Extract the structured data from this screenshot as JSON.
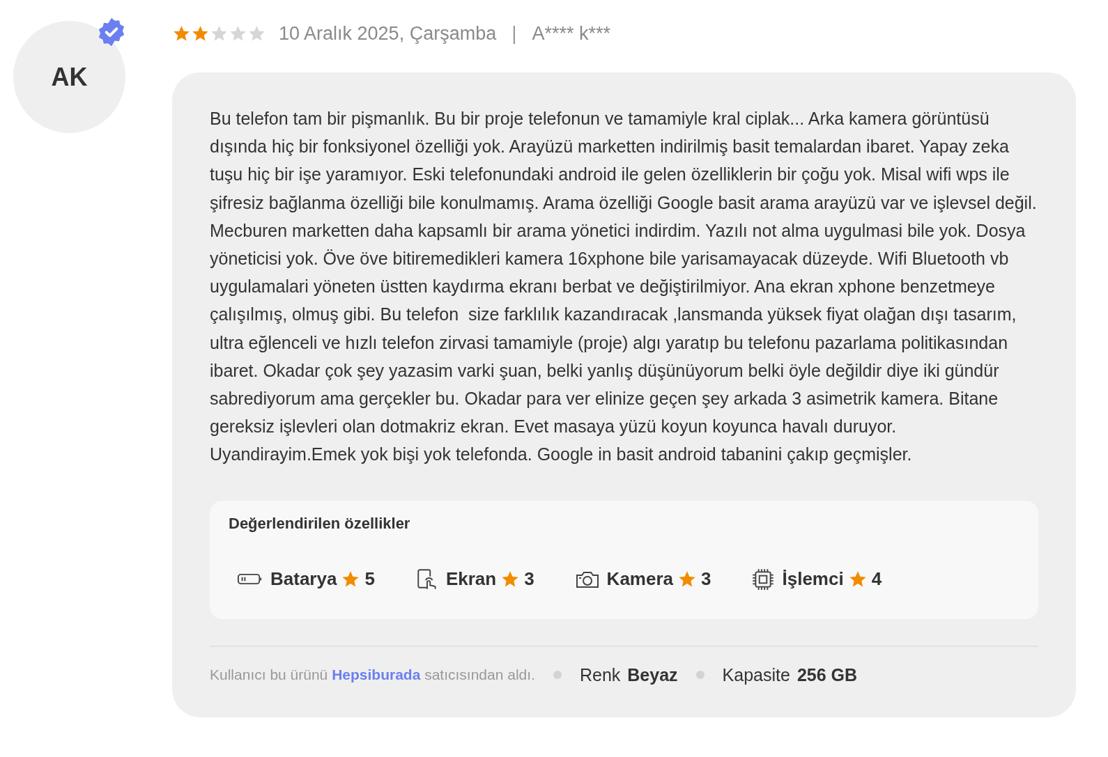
{
  "reviewer": {
    "initials": "AK",
    "verified": true
  },
  "review": {
    "stars": 2,
    "date": "10 Aralık 2025, Çarşamba",
    "separator": "|",
    "author": "A**** k***",
    "text": "Bu telefon tam bir pişmanlık. Bu bir proje telefonun ve tamamiyle kral ciplak... Arka kamera görüntüsü dışında hiç bir fonksiyonel özelliği yok. Arayüzü marketten indirilmiş basit temalardan ibaret. Yapay zeka tuşu hiç bir işe yaramıyor. Eski telefonundaki android ile gelen özelliklerin bir çoğu yok. Misal wifi wps ile şifresiz bağlanma özelliği bile konulmamış. Arama özelliği Google basit arama arayüzü var ve işlevsel değil. Mecburen marketten daha kapsamlı bir arama yönetici indirdim. Yazılı not alma uygulmasi bile yok. Dosya yöneticisi yok. Öve öve bitiremedikleri kamera 16xphone bile yarisamayacak düzeyde. Wifi Bluetooth vb uygulamalari yöneten üstten kaydırma ekranı berbat ve değiştirilmiyor. Ana ekran xphone benzetmeye çalışılmış, olmuş gibi. Bu telefon  size farklılık kazandıracak ,lansmanda yüksek fiyat olağan dışı tasarım, ultra eğlenceli ve hızlı telefon zirvasi tamamiyle (proje) algı yaratıp bu telefonu pazarlama politikasından ibaret. Okadar çok şey yazasim varki şuan, belki yanlış düşünüyorum belki öyle değildir diye iki gündür sabrediyorum ama gerçekler bu. Okadar para ver elinize geçen şey arkada 3 asimetrik kamera. Bitane gereksiz işlevleri olan dotmakriz ekran. Evet masaya yüzü koyun koyunca havalı duruyor. Uyandirayim.Emek yok bişi yok telefonda. Google in basit android tabanini çakıp geçmişler."
  },
  "features": {
    "title": "Değerlendirilen özellikler",
    "items": [
      {
        "kind": "battery",
        "label": "Batarya",
        "score": "5"
      },
      {
        "kind": "screen",
        "label": "Ekran",
        "score": "3"
      },
      {
        "kind": "camera",
        "label": "Kamera",
        "score": "3"
      },
      {
        "kind": "processor",
        "label": "İşlemci",
        "score": "4"
      }
    ]
  },
  "footer": {
    "seller_before": "Kullanıcı bu ürünü",
    "seller": "Hepsiburada",
    "seller_after": "satıcısından aldı.",
    "attributes": [
      {
        "label": "Renk",
        "value": "Beyaz"
      },
      {
        "label": "Kapasite",
        "value": "256 GB"
      }
    ]
  }
}
